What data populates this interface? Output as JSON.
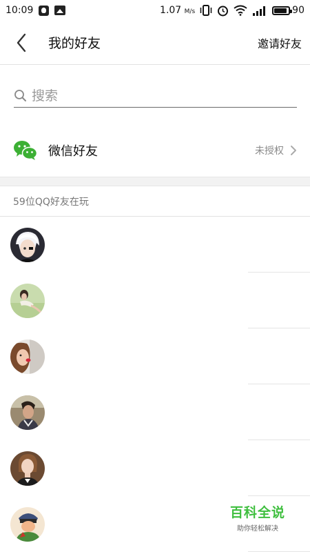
{
  "status_bar": {
    "time": "10:09",
    "speed": "1.07",
    "speed_unit": "M/s",
    "battery": "90",
    "battery_level": 0.9
  },
  "header": {
    "title": "我的好友",
    "invite_label": "邀请好友"
  },
  "search": {
    "placeholder": "搜索"
  },
  "wechat": {
    "label": "微信好友",
    "status": "未授权"
  },
  "friends_section": {
    "header": "59位QQ好友在玩"
  },
  "friends": [
    {
      "avatar": "avatar-anime-white-hair"
    },
    {
      "avatar": "avatar-girl-lying-field"
    },
    {
      "avatar": "avatar-girl-kissing"
    },
    {
      "avatar": "avatar-boy-outdoor"
    },
    {
      "avatar": "avatar-woman-portrait"
    },
    {
      "avatar": "avatar-cartoon-character"
    }
  ],
  "watermark": {
    "title": "百科全说",
    "subtitle": "助你轻松解决"
  },
  "colors": {
    "wechat_green": "#3cb034",
    "watermark_green": "#3fbf3f"
  }
}
